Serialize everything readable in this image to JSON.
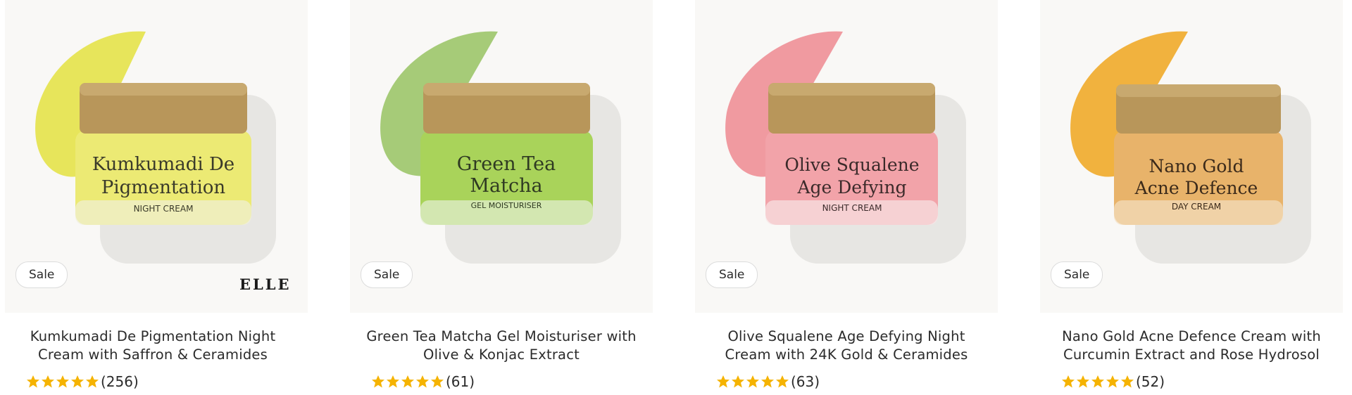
{
  "products": [
    {
      "title": "Kumkumadi De Pigmentation Night Cream with Saffron & Ceramides",
      "badge": "Sale",
      "rating_count": "(256)",
      "rating": 5,
      "jar_label_line1": "Kumkumadi De",
      "jar_label_line2": "Pigmentation",
      "jar_sub": "NIGHT CREAM",
      "press_logo": "ELLE",
      "swatch_color": "#e4e24a",
      "jar_color": "#ecea74"
    },
    {
      "title": "Green Tea Matcha Gel Moisturiser with Olive & Konjac Extract",
      "badge": "Sale",
      "rating_count": "(61)",
      "rating": 5,
      "jar_label_line1": "Green Tea",
      "jar_label_line2": "Matcha",
      "jar_sub": "GEL MOISTURISER",
      "swatch_color": "#9cc56a",
      "jar_color": "#a9d35a"
    },
    {
      "title": "Olive Squalene Age Defying Night Cream with 24K Gold & Ceramides",
      "badge": "Sale",
      "rating_count": "(63)",
      "rating": 5,
      "jar_label_line1": "Olive Squalene",
      "jar_label_line2": "Age Defying",
      "jar_sub": "NIGHT CREAM",
      "swatch_color": "#ee8f97",
      "jar_color": "#f2a3a9"
    },
    {
      "title": "Nano Gold Acne Defence Cream with Curcumin Extract and Rose Hydrosol",
      "badge": "Sale",
      "rating_count": "(52)",
      "rating": 5,
      "jar_label_line1": "Nano Gold",
      "jar_label_line2": "Acne Defence",
      "jar_sub": "DAY CREAM",
      "swatch_color": "#f0aa2a",
      "jar_color": "#e8b36a"
    }
  ],
  "colors": {
    "star": "#f5b301",
    "cap_gold": "#b8965a"
  }
}
